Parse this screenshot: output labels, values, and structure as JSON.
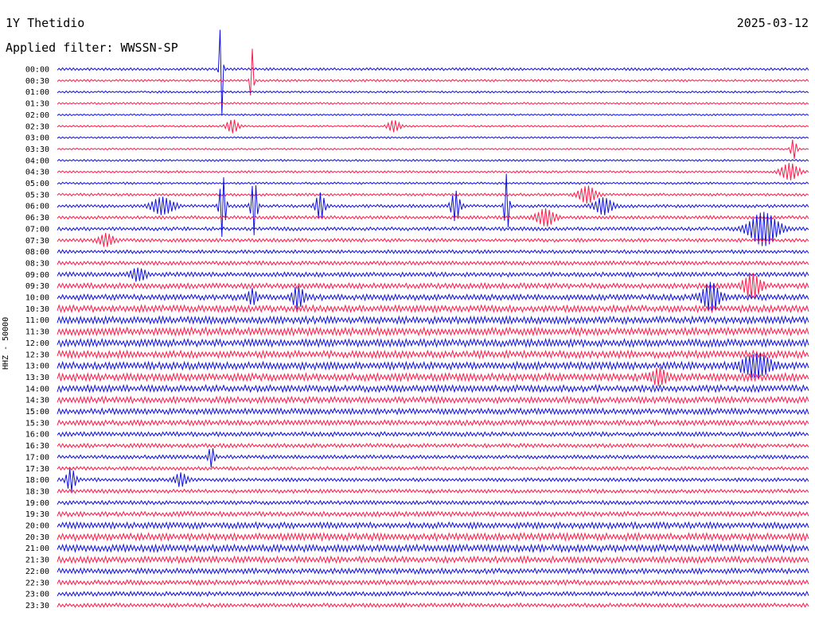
{
  "header": {
    "station": "1Y Thetidio",
    "date": "2025-03-12",
    "filter": "Applied filter: WWSSN-SP",
    "channel_label": "HHZ - 50000"
  },
  "colors": {
    "line_a": "#1010e0",
    "line_b": "#ff1a4a"
  },
  "chart_data": {
    "type": "line",
    "title": "1Y Thetidio",
    "subtitle": "Applied filter: WWSSN-SP",
    "ylabel": "HHZ - 50000",
    "xlabel": "",
    "row_labels": [
      "00:00",
      "00:30",
      "01:00",
      "01:30",
      "02:00",
      "02:30",
      "03:00",
      "03:30",
      "04:00",
      "04:30",
      "05:00",
      "05:30",
      "06:00",
      "06:30",
      "07:00",
      "07:30",
      "08:00",
      "08:30",
      "09:00",
      "09:30",
      "10:00",
      "10:30",
      "11:00",
      "11:30",
      "12:00",
      "12:30",
      "13:00",
      "13:30",
      "14:00",
      "14:30",
      "15:00",
      "15:30",
      "16:00",
      "16:30",
      "17:00",
      "17:30",
      "18:00",
      "18:30",
      "19:00",
      "19:30",
      "20:00",
      "20:30",
      "21:00",
      "21:30",
      "22:00",
      "22:30",
      "23:00",
      "23:30"
    ],
    "noise_level": [
      1.2,
      1.0,
      0.9,
      0.9,
      0.8,
      0.8,
      0.8,
      0.8,
      0.9,
      1.0,
      1.0,
      1.2,
      1.4,
      1.5,
      1.6,
      1.6,
      1.6,
      1.8,
      2.0,
      2.4,
      2.6,
      3.0,
      3.2,
      3.4,
      3.3,
      3.2,
      3.3,
      3.4,
      3.0,
      2.8,
      2.6,
      2.4,
      2.0,
      1.8,
      1.7,
      1.6,
      1.6,
      1.7,
      1.8,
      2.2,
      2.8,
      3.2,
      3.2,
      2.8,
      2.4,
      2.2,
      2.0,
      1.8
    ],
    "events": [
      {
        "row": 0,
        "pos": 0.218,
        "amp": 75,
        "width": 0.002
      },
      {
        "row": 1,
        "pos": 0.259,
        "amp": 42,
        "width": 0.002
      },
      {
        "row": 5,
        "pos": 0.233,
        "amp": 8,
        "width": 0.008
      },
      {
        "row": 5,
        "pos": 0.448,
        "amp": 7,
        "width": 0.008
      },
      {
        "row": 7,
        "pos": 0.98,
        "amp": 12,
        "width": 0.004
      },
      {
        "row": 9,
        "pos": 0.975,
        "amp": 10,
        "width": 0.012
      },
      {
        "row": 11,
        "pos": 0.705,
        "amp": 10,
        "width": 0.012
      },
      {
        "row": 12,
        "pos": 0.14,
        "amp": 10,
        "width": 0.015
      },
      {
        "row": 12,
        "pos": 0.22,
        "amp": 40,
        "width": 0.004
      },
      {
        "row": 12,
        "pos": 0.262,
        "amp": 35,
        "width": 0.004
      },
      {
        "row": 12,
        "pos": 0.35,
        "amp": 16,
        "width": 0.006
      },
      {
        "row": 12,
        "pos": 0.53,
        "amp": 18,
        "width": 0.006
      },
      {
        "row": 12,
        "pos": 0.598,
        "amp": 40,
        "width": 0.003
      },
      {
        "row": 12,
        "pos": 0.727,
        "amp": 10,
        "width": 0.012
      },
      {
        "row": 13,
        "pos": 0.65,
        "amp": 10,
        "width": 0.012
      },
      {
        "row": 14,
        "pos": 0.94,
        "amp": 20,
        "width": 0.02
      },
      {
        "row": 15,
        "pos": 0.065,
        "amp": 7,
        "width": 0.01
      },
      {
        "row": 18,
        "pos": 0.108,
        "amp": 7,
        "width": 0.01
      },
      {
        "row": 19,
        "pos": 0.925,
        "amp": 14,
        "width": 0.012
      },
      {
        "row": 20,
        "pos": 0.32,
        "amp": 12,
        "width": 0.008
      },
      {
        "row": 20,
        "pos": 0.26,
        "amp": 9,
        "width": 0.006
      },
      {
        "row": 20,
        "pos": 0.87,
        "amp": 16,
        "width": 0.012
      },
      {
        "row": 26,
        "pos": 0.93,
        "amp": 12,
        "width": 0.02
      },
      {
        "row": 27,
        "pos": 0.8,
        "amp": 9,
        "width": 0.01
      },
      {
        "row": 34,
        "pos": 0.205,
        "amp": 12,
        "width": 0.004
      },
      {
        "row": 36,
        "pos": 0.018,
        "amp": 14,
        "width": 0.006
      },
      {
        "row": 36,
        "pos": 0.165,
        "amp": 8,
        "width": 0.008
      }
    ]
  }
}
